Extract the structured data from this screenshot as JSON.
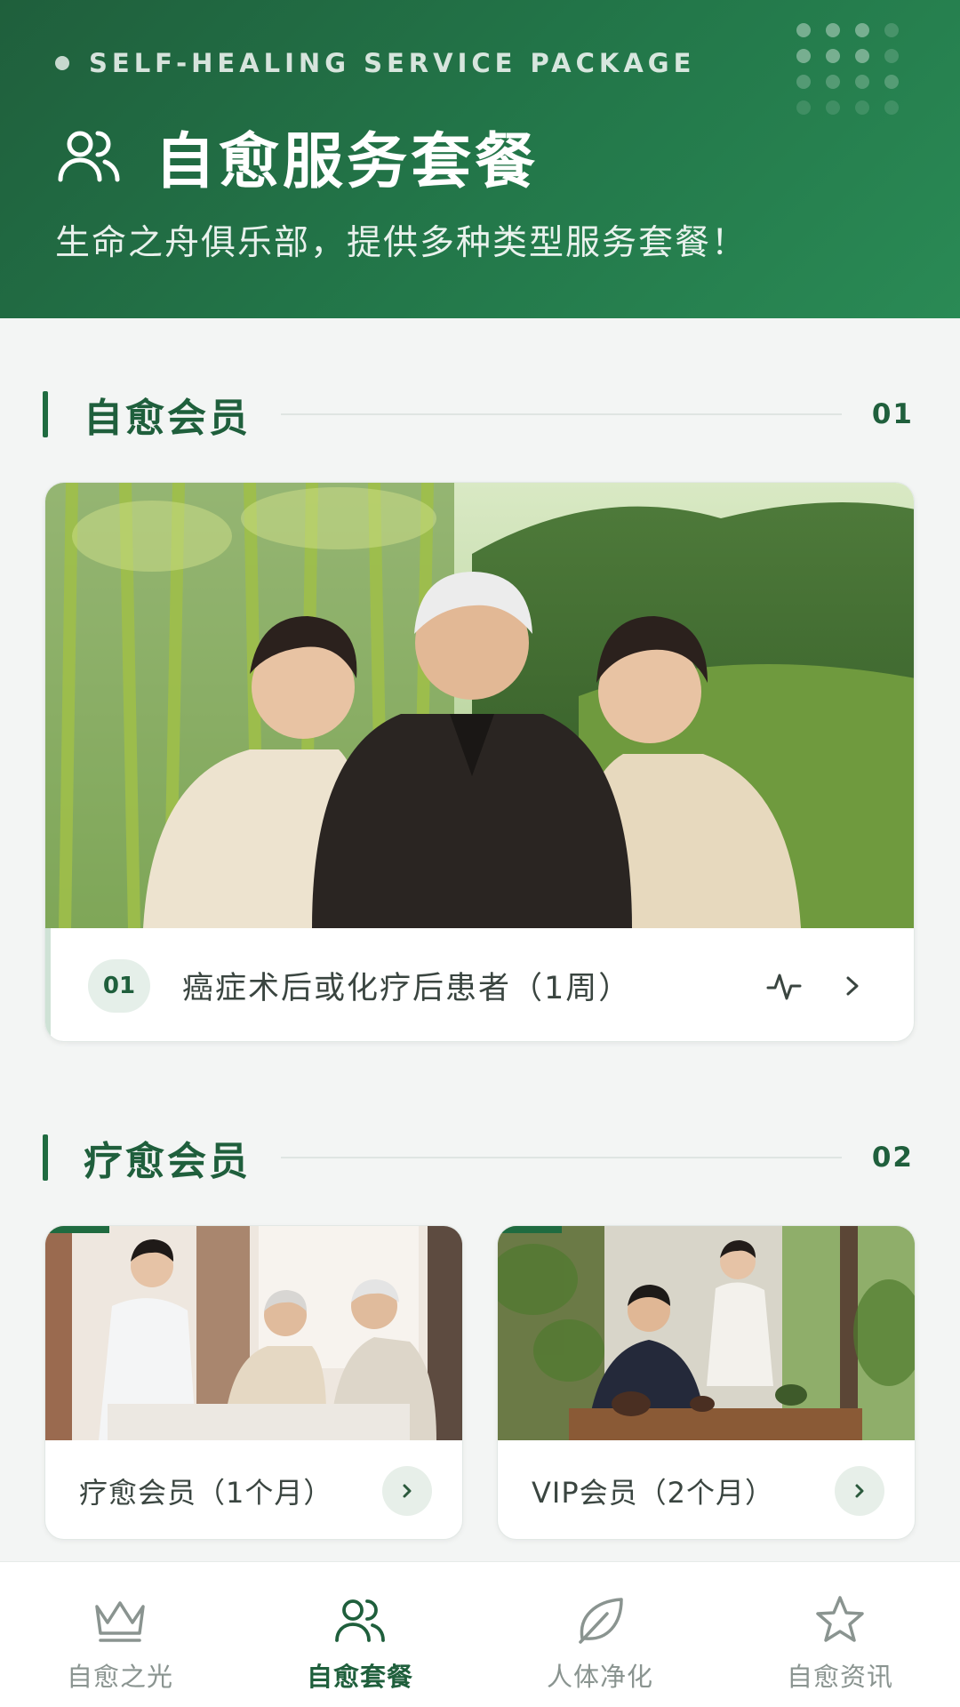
{
  "header": {
    "en_title": "SELF-HEALING SERVICE PACKAGE",
    "title": "自愈服务套餐",
    "subtitle": "生命之舟俱乐部，提供多种类型服务套餐！",
    "icon": "users-icon"
  },
  "sections": [
    {
      "title": "自愈会员",
      "number": "01",
      "items": [
        {
          "badge": "01",
          "label": "癌症术后或化疗后患者（1周）",
          "icons": [
            "pulse-icon",
            "chevron-right-icon"
          ]
        }
      ]
    },
    {
      "title": "疗愈会员",
      "number": "02",
      "items": [
        {
          "label": "疗愈会员（1个月）",
          "icon": "chevron-right-icon"
        },
        {
          "label": "VIP会员（2个月）",
          "icon": "chevron-right-icon"
        }
      ]
    }
  ],
  "bottom_nav": {
    "items": [
      {
        "label": "自愈之光",
        "icon": "crown-icon",
        "active": false
      },
      {
        "label": "自愈套餐",
        "icon": "users-icon",
        "active": true
      },
      {
        "label": "人体净化",
        "icon": "leaf-icon",
        "active": false
      },
      {
        "label": "自愈资讯",
        "icon": "star-icon",
        "active": false
      }
    ]
  },
  "colors": {
    "primary": "#1f5f3c",
    "header_gradient_start": "#1f5f3c",
    "header_gradient_end": "#2a8a55",
    "inactive": "#8a9490"
  }
}
